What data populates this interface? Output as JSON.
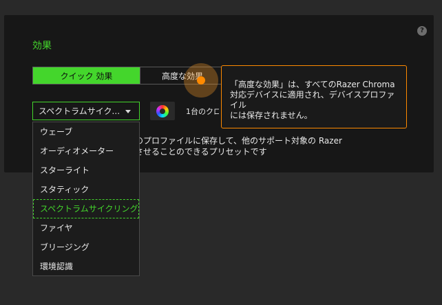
{
  "panel": {
    "title": "効果",
    "help_icon_label": "?"
  },
  "tabs": [
    {
      "label": "クイック 効果",
      "active": true
    },
    {
      "label": "高度な効果",
      "active": false
    }
  ],
  "tooltip": {
    "lines": [
      "「高度な効果」は、すべてのRazer Chroma",
      "対応デバイスに適用され、デバイスプロファイル",
      "には保存されません。"
    ]
  },
  "effect_select": {
    "value": "スペクトラムサイク..."
  },
  "color_button": {
    "icon": "color-wheel-icon"
  },
  "device_count": "1台のクロ",
  "description": {
    "lines": [
      "スのプロファイルに保存して、他のサポート対象の Razer",
      "期させることのできるプリセットです"
    ]
  },
  "dropdown": {
    "options": [
      {
        "label": "ウェーブ",
        "selected": false
      },
      {
        "label": "オーディオメーター",
        "selected": false
      },
      {
        "label": "スターライト",
        "selected": false
      },
      {
        "label": "スタティック",
        "selected": false
      },
      {
        "label": "スペクトラムサイクリング",
        "selected": true
      },
      {
        "label": "ファイヤ",
        "selected": false
      },
      {
        "label": "ブリージング",
        "selected": false
      },
      {
        "label": "環境認識",
        "selected": false
      }
    ]
  },
  "colors": {
    "accent": "#44d62c",
    "highlight": "#ff8a00",
    "panel_bg": "#171717",
    "page_bg": "#292929"
  }
}
